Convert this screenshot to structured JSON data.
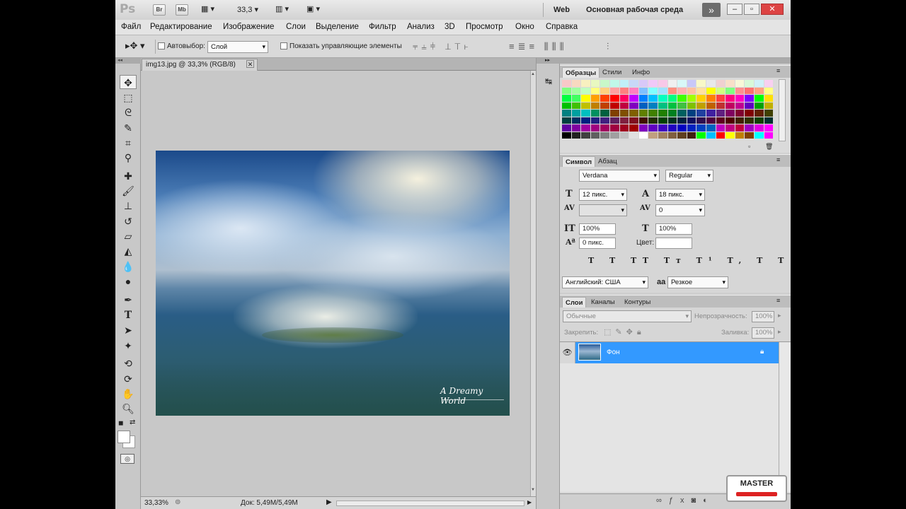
{
  "app": {
    "logo": "Ps",
    "bridge_label": "Br",
    "mini_label": "Mb",
    "zoom_value": "33,3",
    "workspace_web": "Web",
    "workspace_main": "Основная рабочая среда"
  },
  "menu": [
    "Файл",
    "Редактирование",
    "Изображение",
    "Слои",
    "Выделение",
    "Фильтр",
    "Анализ",
    "3D",
    "Просмотр",
    "Окно",
    "Справка"
  ],
  "options": {
    "autoselect_label": "Автовыбор:",
    "autoselect_value": "Слой",
    "show_controls_label": "Показать управляющие элементы"
  },
  "document": {
    "tab_title": "img13.jpg @ 33,3% (RGB/8)",
    "close": "✕",
    "watermark": "A Dreamy World"
  },
  "status": {
    "zoom": "33,33%",
    "doc_size": "Док: 5,49M/5,49M"
  },
  "swatches_panel": {
    "tabs": [
      "Образцы",
      "Стили",
      "Инфо"
    ]
  },
  "character_panel": {
    "tabs": [
      "Символ",
      "Абзац"
    ],
    "font_family": "Verdana",
    "font_style": "Regular",
    "font_size": "12 пикс.",
    "leading": "18 пикс.",
    "kerning": "",
    "tracking": "0",
    "vscale": "100%",
    "hscale": "100%",
    "baseline": "0 пикс.",
    "color_label": "Цвет:",
    "language": "Английский: США",
    "aa_label": "aa",
    "antialias": "Резкое"
  },
  "layers_panel": {
    "tabs": [
      "Слои",
      "Каналы",
      "Контуры"
    ],
    "blend_mode": "Обычные",
    "opacity_label": "Непрозрачность:",
    "opacity": "100%",
    "lock_label": "Закрепить:",
    "fill_label": "Заливка:",
    "fill": "100%",
    "layers": [
      {
        "name": "Фон"
      }
    ]
  },
  "brand": {
    "badge": "MASTER"
  },
  "colors": {
    "accent": "#3399ff"
  }
}
